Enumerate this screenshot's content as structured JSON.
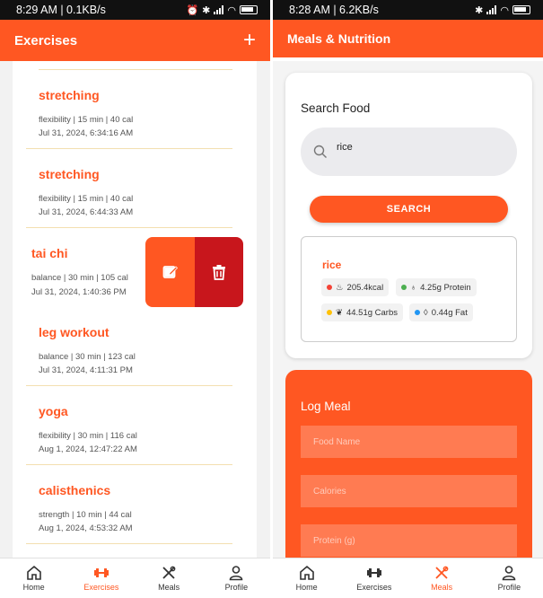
{
  "left": {
    "status": {
      "time": "8:29 AM | 0.1KB/s"
    },
    "appbar": {
      "title": "Exercises",
      "add": "+"
    },
    "exercises": [
      {
        "name": "stretching",
        "meta": "flexibility | 15 min | 40 cal",
        "date": "Jul 31, 2024, 6:34:16 AM"
      },
      {
        "name": "stretching",
        "meta": "flexibility | 15 min | 40 cal",
        "date": "Jul 31, 2024, 6:44:33 AM"
      },
      {
        "name": "tai chi",
        "meta": "balance | 30 min | 105 cal",
        "date": "Jul 31, 2024, 1:40:36 PM"
      },
      {
        "name": "leg workout",
        "meta": "balance | 30 min | 123 cal",
        "date": "Jul 31, 2024, 4:11:31 PM"
      },
      {
        "name": "yoga",
        "meta": "flexibility | 30 min | 116 cal",
        "date": "Aug 1, 2024, 12:47:22 AM"
      },
      {
        "name": "calisthenics",
        "meta": "strength | 10 min | 44 cal",
        "date": "Aug 1, 2024, 4:53:32 AM"
      }
    ],
    "nav": {
      "home": "Home",
      "exercises": "Exercises",
      "meals": "Meals",
      "profile": "Profile",
      "active": "exercises"
    }
  },
  "right": {
    "status": {
      "time": "8:28 AM | 6.2KB/s"
    },
    "appbar": {
      "title": "Meals & Nutrition"
    },
    "search": {
      "title": "Search Food",
      "value": "rice",
      "button": "SEARCH",
      "result": {
        "name": "rice",
        "calories": "205.4kcal",
        "protein": "4.25g Protein",
        "carbs": "44.51g Carbs",
        "fat": "0.44g Fat"
      }
    },
    "log": {
      "title": "Log Meal",
      "food_placeholder": "Food Name",
      "calories_placeholder": "Calories",
      "protein_placeholder": "Protein (g)"
    },
    "nav": {
      "home": "Home",
      "exercises": "Exercises",
      "meals": "Meals",
      "profile": "Profile",
      "active": "meals"
    }
  },
  "colors": {
    "accent": "#ff5722",
    "delete": "#c8161c",
    "calories": "#f44336",
    "protein": "#4caf50",
    "carbs": "#ffc107",
    "fat": "#2196f3"
  },
  "icons": [
    "edit-icon",
    "trash-icon",
    "search-icon",
    "home-icon",
    "dumbbell-icon",
    "utensils-icon",
    "person-icon",
    "fire-icon",
    "apple-icon",
    "leaf-icon",
    "drop-icon"
  ]
}
